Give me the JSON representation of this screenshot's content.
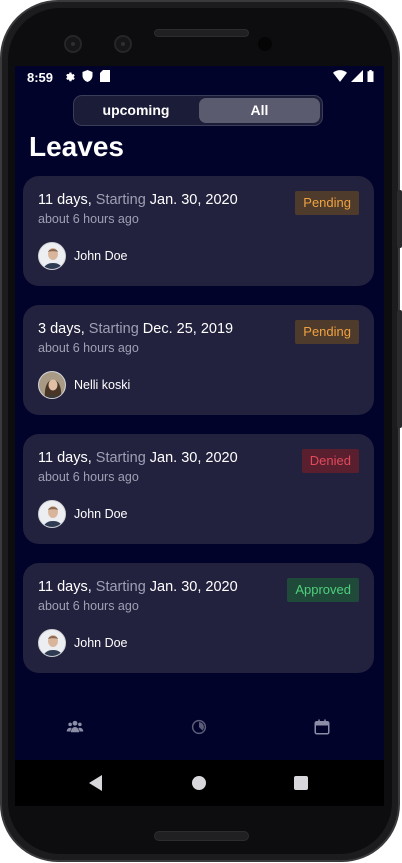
{
  "status_bar": {
    "time": "8:59",
    "left_icons": [
      "gear-icon",
      "shield-icon",
      "sd-card-icon"
    ],
    "right_icons": [
      "wifi-icon",
      "signal-icon",
      "battery-icon"
    ]
  },
  "segment": {
    "options": [
      "upcoming",
      "All"
    ],
    "selected": "All"
  },
  "page_title": "Leaves",
  "leaves": [
    {
      "duration": "11 days,",
      "starting_label": "Starting",
      "date": "Jan. 30, 2020",
      "ago": "about 6 hours ago",
      "status": "Pending",
      "person": "John Doe",
      "avatar": "man"
    },
    {
      "duration": "3 days,",
      "starting_label": "Starting",
      "date": "Dec. 25, 2019",
      "ago": "about 6 hours ago",
      "status": "Pending",
      "person": "Nelli koski",
      "avatar": "woman"
    },
    {
      "duration": "11 days,",
      "starting_label": "Starting",
      "date": "Jan. 30, 2020",
      "ago": "about 6 hours ago",
      "status": "Denied",
      "person": "John Doe",
      "avatar": "man"
    },
    {
      "duration": "11 days,",
      "starting_label": "Starting",
      "date": "Jan. 30, 2020",
      "ago": "about 6 hours ago",
      "status": "Approved",
      "person": "John Doe",
      "avatar": "man"
    }
  ],
  "tabs": [
    "people-icon",
    "history-icon",
    "calendar-icon"
  ],
  "colors": {
    "background": "#02032b",
    "card": "#22223e",
    "pending": "#f0a240",
    "denied": "#e04a5c",
    "approved": "#4fd07b"
  }
}
